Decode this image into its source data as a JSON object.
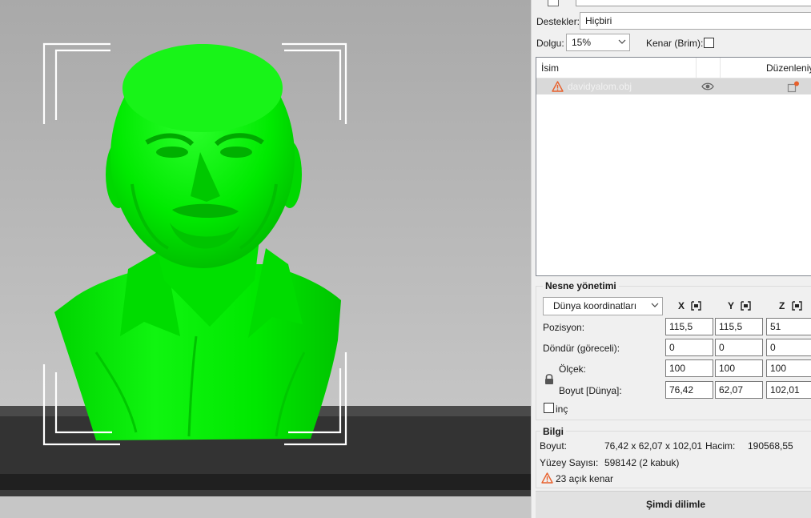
{
  "supports": {
    "label": "Destekler:",
    "value": "Hiçbiri"
  },
  "infill": {
    "label": "Dolgu:",
    "value": "15%"
  },
  "brim": {
    "label": "Kenar (Brim):",
    "checked": false
  },
  "object_list": {
    "columns": [
      "İsim",
      "Düzenleniy"
    ],
    "rows": [
      {
        "name": "davidyalom.obj",
        "status_icon": "warning-icon",
        "visible_icon": "eye-icon",
        "edit_icon": "edit-warning-icon"
      }
    ]
  },
  "object_management": {
    "title": "Nesne yönetimi",
    "coord_system": "Dünya koordinatları",
    "axes": [
      "X",
      "Y",
      "Z"
    ],
    "rows": [
      {
        "label": "Pozisyon:",
        "values": [
          "115,5",
          "115,5",
          "51"
        ]
      },
      {
        "label": "Döndür (göreceli):",
        "values": [
          "0",
          "0",
          "0"
        ]
      },
      {
        "label": "Ölçek:",
        "values": [
          "100",
          "100",
          "100"
        ]
      },
      {
        "label": "Boyut [Dünya]:",
        "values": [
          "76,42",
          "62,07",
          "102,01"
        ]
      }
    ],
    "inch": {
      "label": "inç",
      "checked": false
    }
  },
  "info": {
    "title": "Bilgi",
    "size_label": "Boyut:",
    "size_value": "76,42 x 62,07 x 102,01",
    "volume_label": "Hacim:",
    "volume_value": "190568,55",
    "facets_label": "Yüzey Sayısı:",
    "facets_value": "598142 (2 kabuk)",
    "warning": "23 açık kenar"
  },
  "slice_button": "Şimdi dilimle",
  "colors": {
    "model": "#00f000",
    "bed": "#2f2f2f",
    "warning": "#e8602c"
  }
}
